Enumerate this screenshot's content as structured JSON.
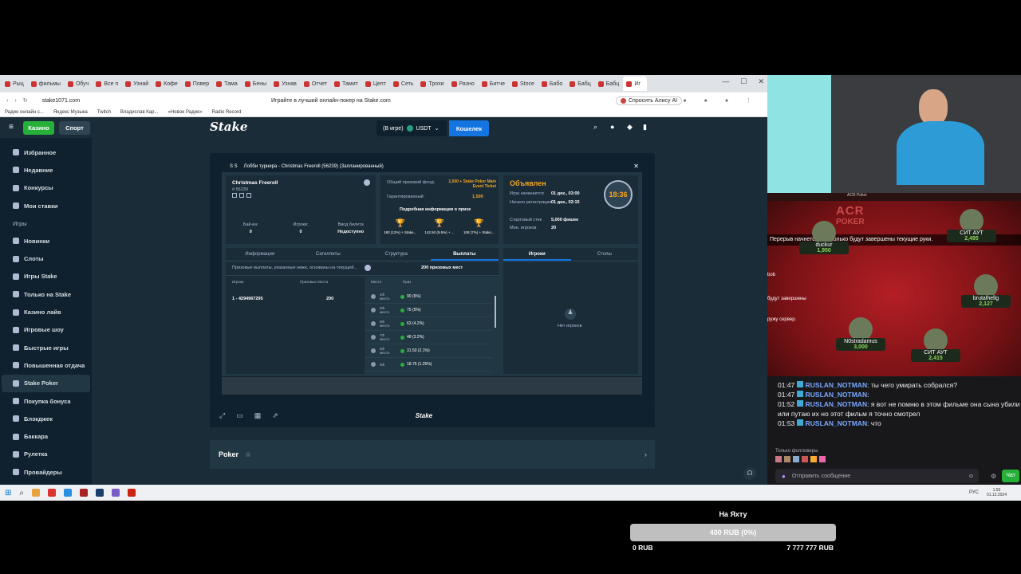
{
  "browser": {
    "tabs": [
      "Рыц",
      "фильмы",
      "Обуч",
      "Все п",
      "Узнай",
      "Кофе",
      "Повер",
      "Тама",
      "Бены",
      "Узнав",
      "Отчет",
      "Тамит",
      "Цепт",
      "Сеть",
      "Трохи",
      "Разно",
      "Битче",
      "Stoce",
      "Бабо",
      "Бабц",
      "Бабц",
      "Иг"
    ],
    "url": "stake1071.com",
    "page_title": "Играйте в лучший онлайн-покер на Stake.com",
    "alice": "Спросить Алису AI",
    "bookmarks": [
      "Радио онлайн с...",
      "Яндекс Музыка",
      "Twitch",
      "Владислав Кар...",
      "«Новое Радио»",
      "Radio Record"
    ]
  },
  "site": {
    "nav": {
      "casino": "Казино",
      "sport": "Спорт",
      "logo": "Stake",
      "balance": "(В игре)",
      "currency": "USDT",
      "wallet": "Кошелек"
    },
    "sidebar_top": [
      "Избранное",
      "Недавние",
      "Конкурсы",
      "Мои ставки"
    ],
    "games_header": "Игры",
    "sidebar_games": [
      "Новинки",
      "Слоты",
      "Игры Stake",
      "Только на Stake",
      "Казино лайв",
      "Игровые шоу",
      "Быстрые игры",
      "Повышенная отдача",
      "Stake Poker",
      "Покупка бонуса",
      "Блэкджек",
      "Баккара",
      "Рулетка",
      "Провайдеры"
    ],
    "active_item": "Stake Poker",
    "poker_title": "Poker",
    "footer_logo": "Stake"
  },
  "lobby": {
    "title": "Лобби турнира - Christmas Freeroll (56239) (Запланированный)",
    "name": "Christmas Freeroll",
    "id": "# 56239",
    "prize_fund_label": "Общий призовой фонд:",
    "prize_fund_value": "1,500 + Stake Poker Main Event Ticket",
    "guaranteed_label": "Гарантированный:",
    "guaranteed_value": "1,500",
    "prize_info": "Подробная информация о призе",
    "trophies": [
      "180 (12%) + Stake...",
      "142.50 (9.5%) + ...",
      "108 (7%) + Stake..."
    ],
    "status": "Объявлен",
    "start_label": "Игра начинается",
    "start_value": "01 дек., 03:00",
    "reg_label": "Начало регистрации",
    "reg_value": "01 дек., 02:15",
    "timer": "18:36",
    "stack_label": "Стартовый стек",
    "stack_value": "5,000 фишек",
    "min_players_label": "Мин. игроков",
    "min_players_value": "20",
    "stats": [
      {
        "label": "Бай-ин:",
        "value": "0"
      },
      {
        "label": "Игроки:",
        "value": "0"
      },
      {
        "label": "Ввод билета",
        "value": "Недоступно"
      }
    ],
    "tabs": [
      "Информация",
      "Сателлиты",
      "Структура",
      "Выплаты"
    ],
    "right_tabs": [
      "Игроки",
      "Столы"
    ],
    "note": "Призовые выплаты, указанные ниже, основаны на текущей...",
    "places": "200 призовых мест",
    "table_headers": [
      "Игроки",
      "Призовые Места"
    ],
    "row": {
      "players": "1 - 4294967295",
      "places": "200"
    },
    "payout_headers": [
      "Место",
      "Приз"
    ],
    "payouts": [
      {
        "place": "4th",
        "place2": "место",
        "prize": "90 (6%)"
      },
      {
        "place": "5th",
        "place2": "место",
        "prize": "75 (5%)"
      },
      {
        "place": "6th",
        "place2": "место",
        "prize": "63 (4.2%)"
      },
      {
        "place": "7th",
        "place2": "место",
        "prize": "48 (3.2%)"
      },
      {
        "place": "8th",
        "place2": "место",
        "prize": "31.50 (2.1%)"
      },
      {
        "place": "9th",
        "place2": "",
        "prize": "18.75 (1.25%)"
      }
    ],
    "no_players": "Нет игроков"
  },
  "stream": {
    "header": "ACR Poker",
    "logo_acr": "ACR",
    "logo_poker": "POKER",
    "message": "Перерыв начнется, как только будут завершены текущие руки.",
    "players": [
      {
        "name": "duckur",
        "stack": "1,950"
      },
      {
        "name": "СИТ АУТ",
        "stack": "2,495"
      },
      {
        "name": "brutalhellg",
        "stack": "2,127"
      },
      {
        "name": "N0stradamus",
        "stack": "3,000"
      },
      {
        "name": "СИТ АУТ",
        "stack": "2,415"
      }
    ],
    "side_text": [
      "bob",
      "будут завершены",
      "ружу сервер."
    ]
  },
  "chat": {
    "messages": [
      {
        "time": "01:47",
        "user": "RUSLAN_NOTMAN",
        "text": ": ты чего умирать собрался?"
      },
      {
        "time": "01:47",
        "user": "RUSLAN_NOTMAN",
        "text": ":"
      },
      {
        "time": "01:52",
        "user": "RUSLAN_NOTMAN",
        "text": ": я вот не помню в этом фильме она сына убили или путаю их но этот фильм я точно смотрел"
      },
      {
        "time": "01:53",
        "user": "RUSLAN_NOTMAN",
        "text": ": что"
      }
    ],
    "followers_only": "Только фолловеры",
    "input_placeholder": "Отправить сообщение",
    "send": "Чат"
  },
  "taskbar": {
    "lang": "РУС",
    "time": "1:56",
    "date": "01.12.2024"
  },
  "overlay": {
    "title": "На Яхту",
    "bar_text": "400 RUB (0%)",
    "min": "0 RUB",
    "max": "7 777 777 RUB",
    "progress_pct": 0
  },
  "colors": {
    "stake_bg": "#1a2c38",
    "sidebar": "#0f212e",
    "green": "#1fff20",
    "blue": "#1475e1",
    "gold": "#f5a623"
  }
}
